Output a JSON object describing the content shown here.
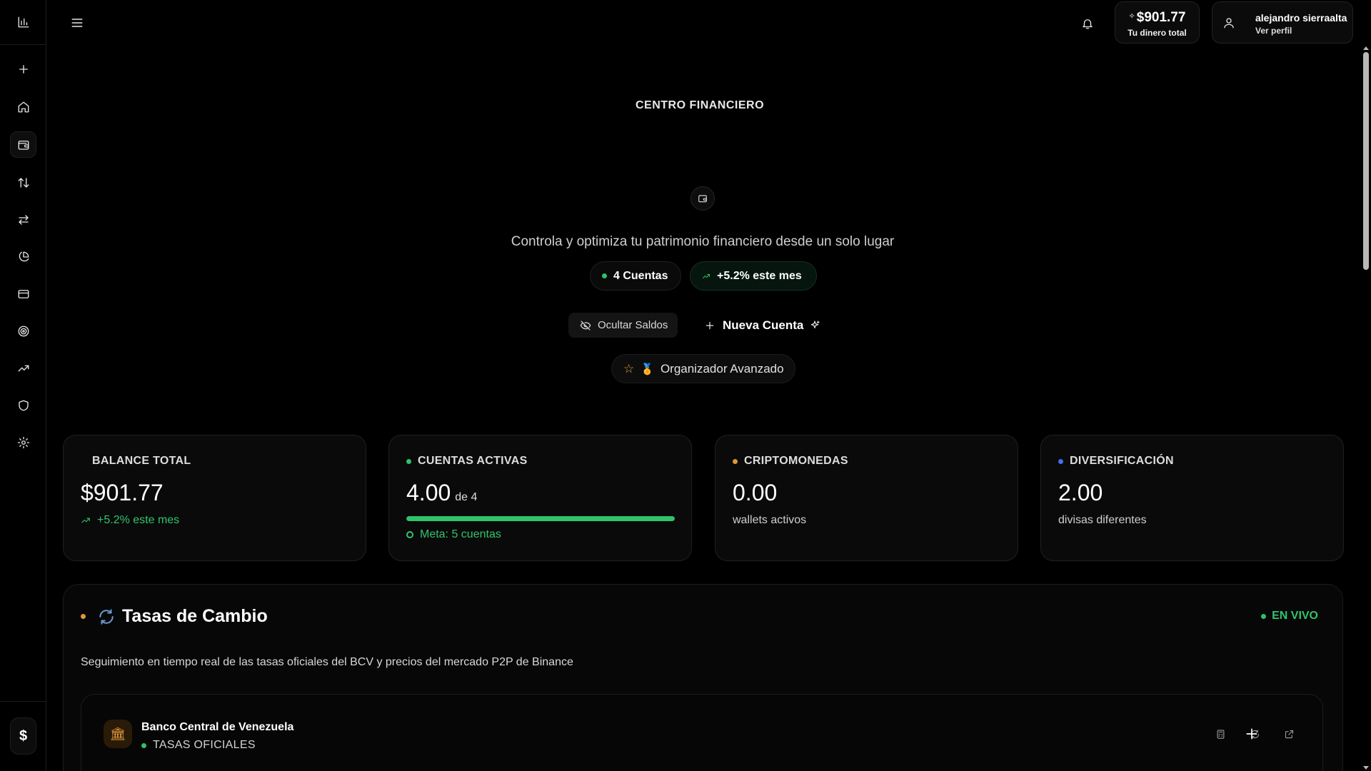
{
  "sidebar": {
    "logo_icon": "bar-chart-icon",
    "items": [
      {
        "icon": "plus-icon"
      },
      {
        "icon": "home-icon"
      },
      {
        "icon": "wallet-icon",
        "active": true
      },
      {
        "icon": "arrows-up-down-icon"
      },
      {
        "icon": "arrows-left-right-icon"
      },
      {
        "icon": "pie-chart-icon"
      },
      {
        "icon": "credit-card-icon"
      },
      {
        "icon": "target-icon"
      },
      {
        "icon": "trending-up-icon"
      },
      {
        "icon": "shield-icon"
      },
      {
        "icon": "settings-icon"
      }
    ],
    "bottom_symbol": "$"
  },
  "topbar": {
    "total_amount": "$901.77",
    "total_label": "Tu dinero total",
    "user_name": "alejandro sierraalta",
    "profile_link": "Ver perfil"
  },
  "hero": {
    "title": "CENTRO FINANCIERO",
    "description": "Controla y optimiza tu patrimonio financiero desde un solo lugar",
    "accounts_chip": "4 Cuentas",
    "growth_chip": "+5.2% este mes",
    "hide_button": "Ocultar Saldos",
    "new_account_button": "Nueva Cuenta",
    "badge": "Organizador Avanzado"
  },
  "stats": {
    "balance": {
      "title": "BALANCE TOTAL",
      "value": "$901.77",
      "sub": "+5.2% este mes"
    },
    "accounts": {
      "title": "CUENTAS ACTIVAS",
      "value": "4.00",
      "of": "de 4",
      "progress": 1.0,
      "goal": "Meta: 5 cuentas"
    },
    "crypto": {
      "title": "CRIPTOMONEDAS",
      "value": "0.00",
      "sub": "wallets activos"
    },
    "diversification": {
      "title": "DIVERSIFICACIÓN",
      "value": "2.00",
      "sub": "divisas diferentes"
    }
  },
  "rates": {
    "title": "Tasas de Cambio",
    "live_label": "EN VIVO",
    "description": "Seguimiento en tiempo real de las tasas oficiales del BCV y precios del mercado P2P de Binance",
    "bank": {
      "name": "Banco Central de Venezuela",
      "sub": "TASAS OFICIALES"
    }
  },
  "colors": {
    "accent_green": "#2ec26a",
    "accent_orange": "#e2963a",
    "accent_blue": "#4a6cf0",
    "background": "#000000"
  }
}
